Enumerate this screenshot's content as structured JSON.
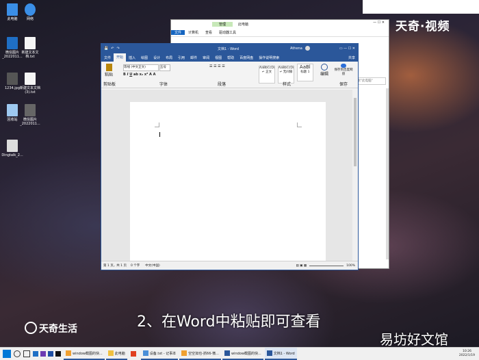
{
  "desktop": {
    "icons": [
      {
        "label": "此电脑",
        "color": "#3a8ee6"
      },
      {
        "label": "网络",
        "color": "#3a8ee6"
      },
      {
        "label": "微信图片_2022011...",
        "color": "#1f6fc5"
      },
      {
        "label": "新建文本文档.txt",
        "color": "#f5f5f5"
      },
      {
        "label": "1234.jpg",
        "color": "#555555"
      },
      {
        "label": "新建文本文档(3).txt",
        "color": "#f5f5f5"
      },
      {
        "label": "回收站",
        "color": "#9ec9f0"
      },
      {
        "label": "微信图片_2022011...",
        "color": "#666666"
      },
      {
        "label": "Dingtalk_2...",
        "color": "#dddddd"
      }
    ]
  },
  "watermarks": {
    "top_right": "天奇·视频",
    "bottom_left": "天奇生活",
    "bottom_right": "易坊好文馆"
  },
  "subtitle": "2、在Word中粘贴即可查看",
  "explorer": {
    "title": "此电脑",
    "tabs": [
      "文件",
      "计算机",
      "查看",
      "驱动器工具"
    ],
    "manage_label": "管理",
    "search_placeholder": "搜索\"此电脑\""
  },
  "word": {
    "title": "文档1 - Word",
    "user": "Athena",
    "tabs": [
      "文件",
      "开始",
      "插入",
      "绘图",
      "设计",
      "布局",
      "引用",
      "邮件",
      "审阅",
      "视图",
      "帮助",
      "百度网盘",
      "操作说明搜索"
    ],
    "share": "共享",
    "ribbon": {
      "paste": "粘贴",
      "clipboard": "剪贴板",
      "font_name": "等线 (中文正文)",
      "font_size": "五号",
      "font_group": "字体",
      "paragraph_group": "段落",
      "styles_group": "样式",
      "styles": [
        {
          "sample": "AaBbCcDi",
          "name": "↵ 正文"
        },
        {
          "sample": "AaBbCcDi",
          "name": "↵ 无间隔"
        },
        {
          "sample": "AaBl",
          "name": "标题 1"
        }
      ],
      "edit": "编辑",
      "save_baidu": "保存到百度网盘",
      "save_group": "保存"
    },
    "status": {
      "page": "第 1 页，共 1 页",
      "words": "0 个字",
      "lang": "中文(中国)",
      "zoom": "100%"
    }
  },
  "taskbar": {
    "items": [
      {
        "label": "window截图的快...",
        "color": "#f0a030"
      },
      {
        "label": "此电脑",
        "color": "#f0c040"
      },
      {
        "label": "",
        "color": "#e04020"
      },
      {
        "label": "设备.txt - 记事本",
        "color": "#4a8fd8"
      },
      {
        "label": "空空如也-抓66-微...",
        "color": "#f0a030"
      },
      {
        "label": "window截图的快...",
        "color": "#2b579a"
      },
      {
        "label": "文档1 - Word",
        "color": "#2b579a"
      }
    ],
    "time": "10:26",
    "date": "2022/1/19"
  }
}
